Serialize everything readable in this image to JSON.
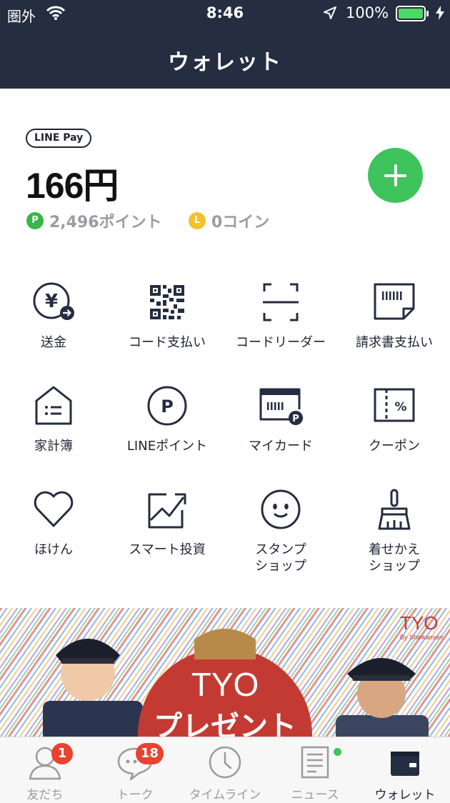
{
  "status_bar": {
    "carrier": "圏外",
    "time": "8:46",
    "battery": "100%",
    "battery_color": "#4cd964"
  },
  "header": {
    "title": "ウォレット"
  },
  "wallet": {
    "badge": "LINE Pay",
    "balance": "166円",
    "points_icon": "P",
    "points": "2,496ポイント",
    "coins_icon": "L",
    "coins": "0コイン",
    "accent_color": "#3fc35c"
  },
  "menu": [
    {
      "label": "送金",
      "icon": "yen-transfer-icon"
    },
    {
      "label": "コード支払い",
      "icon": "qr-code-icon"
    },
    {
      "label": "コードリーダー",
      "icon": "scanner-icon"
    },
    {
      "label": "請求書支払い",
      "icon": "bill-icon"
    },
    {
      "label": "家計簿",
      "icon": "house-ledger-icon"
    },
    {
      "label": "LINEポイント",
      "icon": "points-icon"
    },
    {
      "label": "マイカード",
      "icon": "my-card-icon"
    },
    {
      "label": "クーポン",
      "icon": "coupon-icon"
    },
    {
      "label": "ほけん",
      "icon": "heart-icon"
    },
    {
      "label": "スマート投資",
      "icon": "investment-chart-icon"
    },
    {
      "label": "スタンプ\nショップ",
      "icon": "sticker-face-icon"
    },
    {
      "label": "着せかえ\nショップ",
      "icon": "theme-brush-icon"
    }
  ],
  "banner": {
    "logo": "TYO",
    "logo_sub": "By Shinkansen",
    "headline_1": "TYO",
    "headline_2": "プレゼント"
  },
  "tabs": [
    {
      "label": "友だち",
      "icon": "friends-icon",
      "badge": "1"
    },
    {
      "label": "トーク",
      "icon": "chat-icon",
      "badge": "18"
    },
    {
      "label": "タイムライン",
      "icon": "clock-icon"
    },
    {
      "label": "ニュース",
      "icon": "news-icon"
    },
    {
      "label": "ウォレット",
      "icon": "wallet-icon",
      "active": true
    }
  ]
}
